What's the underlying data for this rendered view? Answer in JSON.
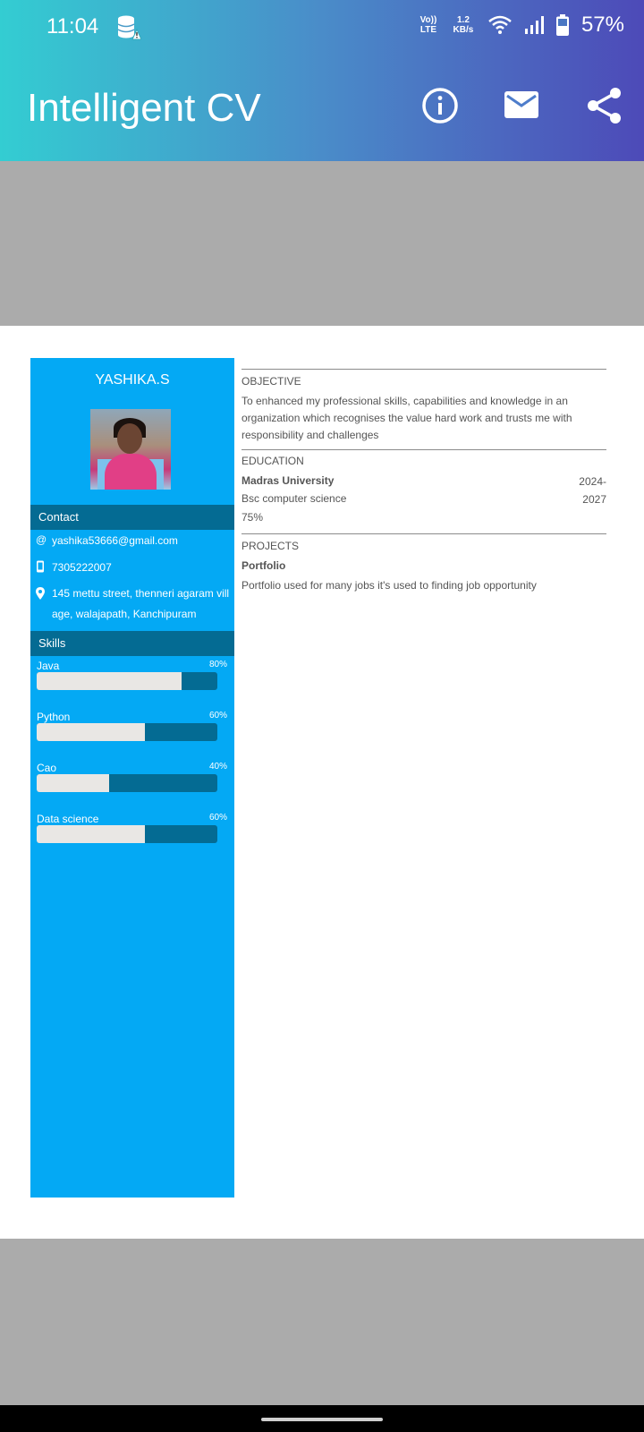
{
  "status": {
    "time": "11:04",
    "volte": "Vo)) LTE",
    "speed": "1.2 KB/s",
    "battery": "57%"
  },
  "app": {
    "title": "Intelligent CV"
  },
  "cv": {
    "name": "YASHIKA.S",
    "contact_title": "Contact",
    "email": "yashika53666@gmail.com",
    "phone": "7305222007",
    "address": "145 mettu street, thenneri agaram village, walajapath, Kanchipuram",
    "skills_title": "Skills",
    "skills": [
      {
        "name": "Java",
        "percent_label": "80%",
        "level": 0.8
      },
      {
        "name": "Python",
        "percent_label": "60%",
        "level": 0.6
      },
      {
        "name": "Cao",
        "percent_label": "40%",
        "level": 0.4
      },
      {
        "name": "Data science",
        "percent_label": "60%",
        "level": 0.6
      }
    ],
    "objective_title": "OBJECTIVE",
    "objective": "To enhanced my professional skills, capabilities and knowledge in an organization which recognises the value hard work and trusts me with responsibility and challenges",
    "education_title": "EDUCATION",
    "university": "Madras University",
    "degree": "Bsc computer science",
    "score": "75%",
    "year_start": "2024-",
    "year_end": "2027",
    "projects_title": "PROJECTS",
    "project_name": "Portfolio",
    "project_desc": "Portfolio used for many jobs it's used to finding job opportunity"
  },
  "icons": {
    "info": "info-icon",
    "mail": "mail-icon",
    "share": "share-icon"
  }
}
